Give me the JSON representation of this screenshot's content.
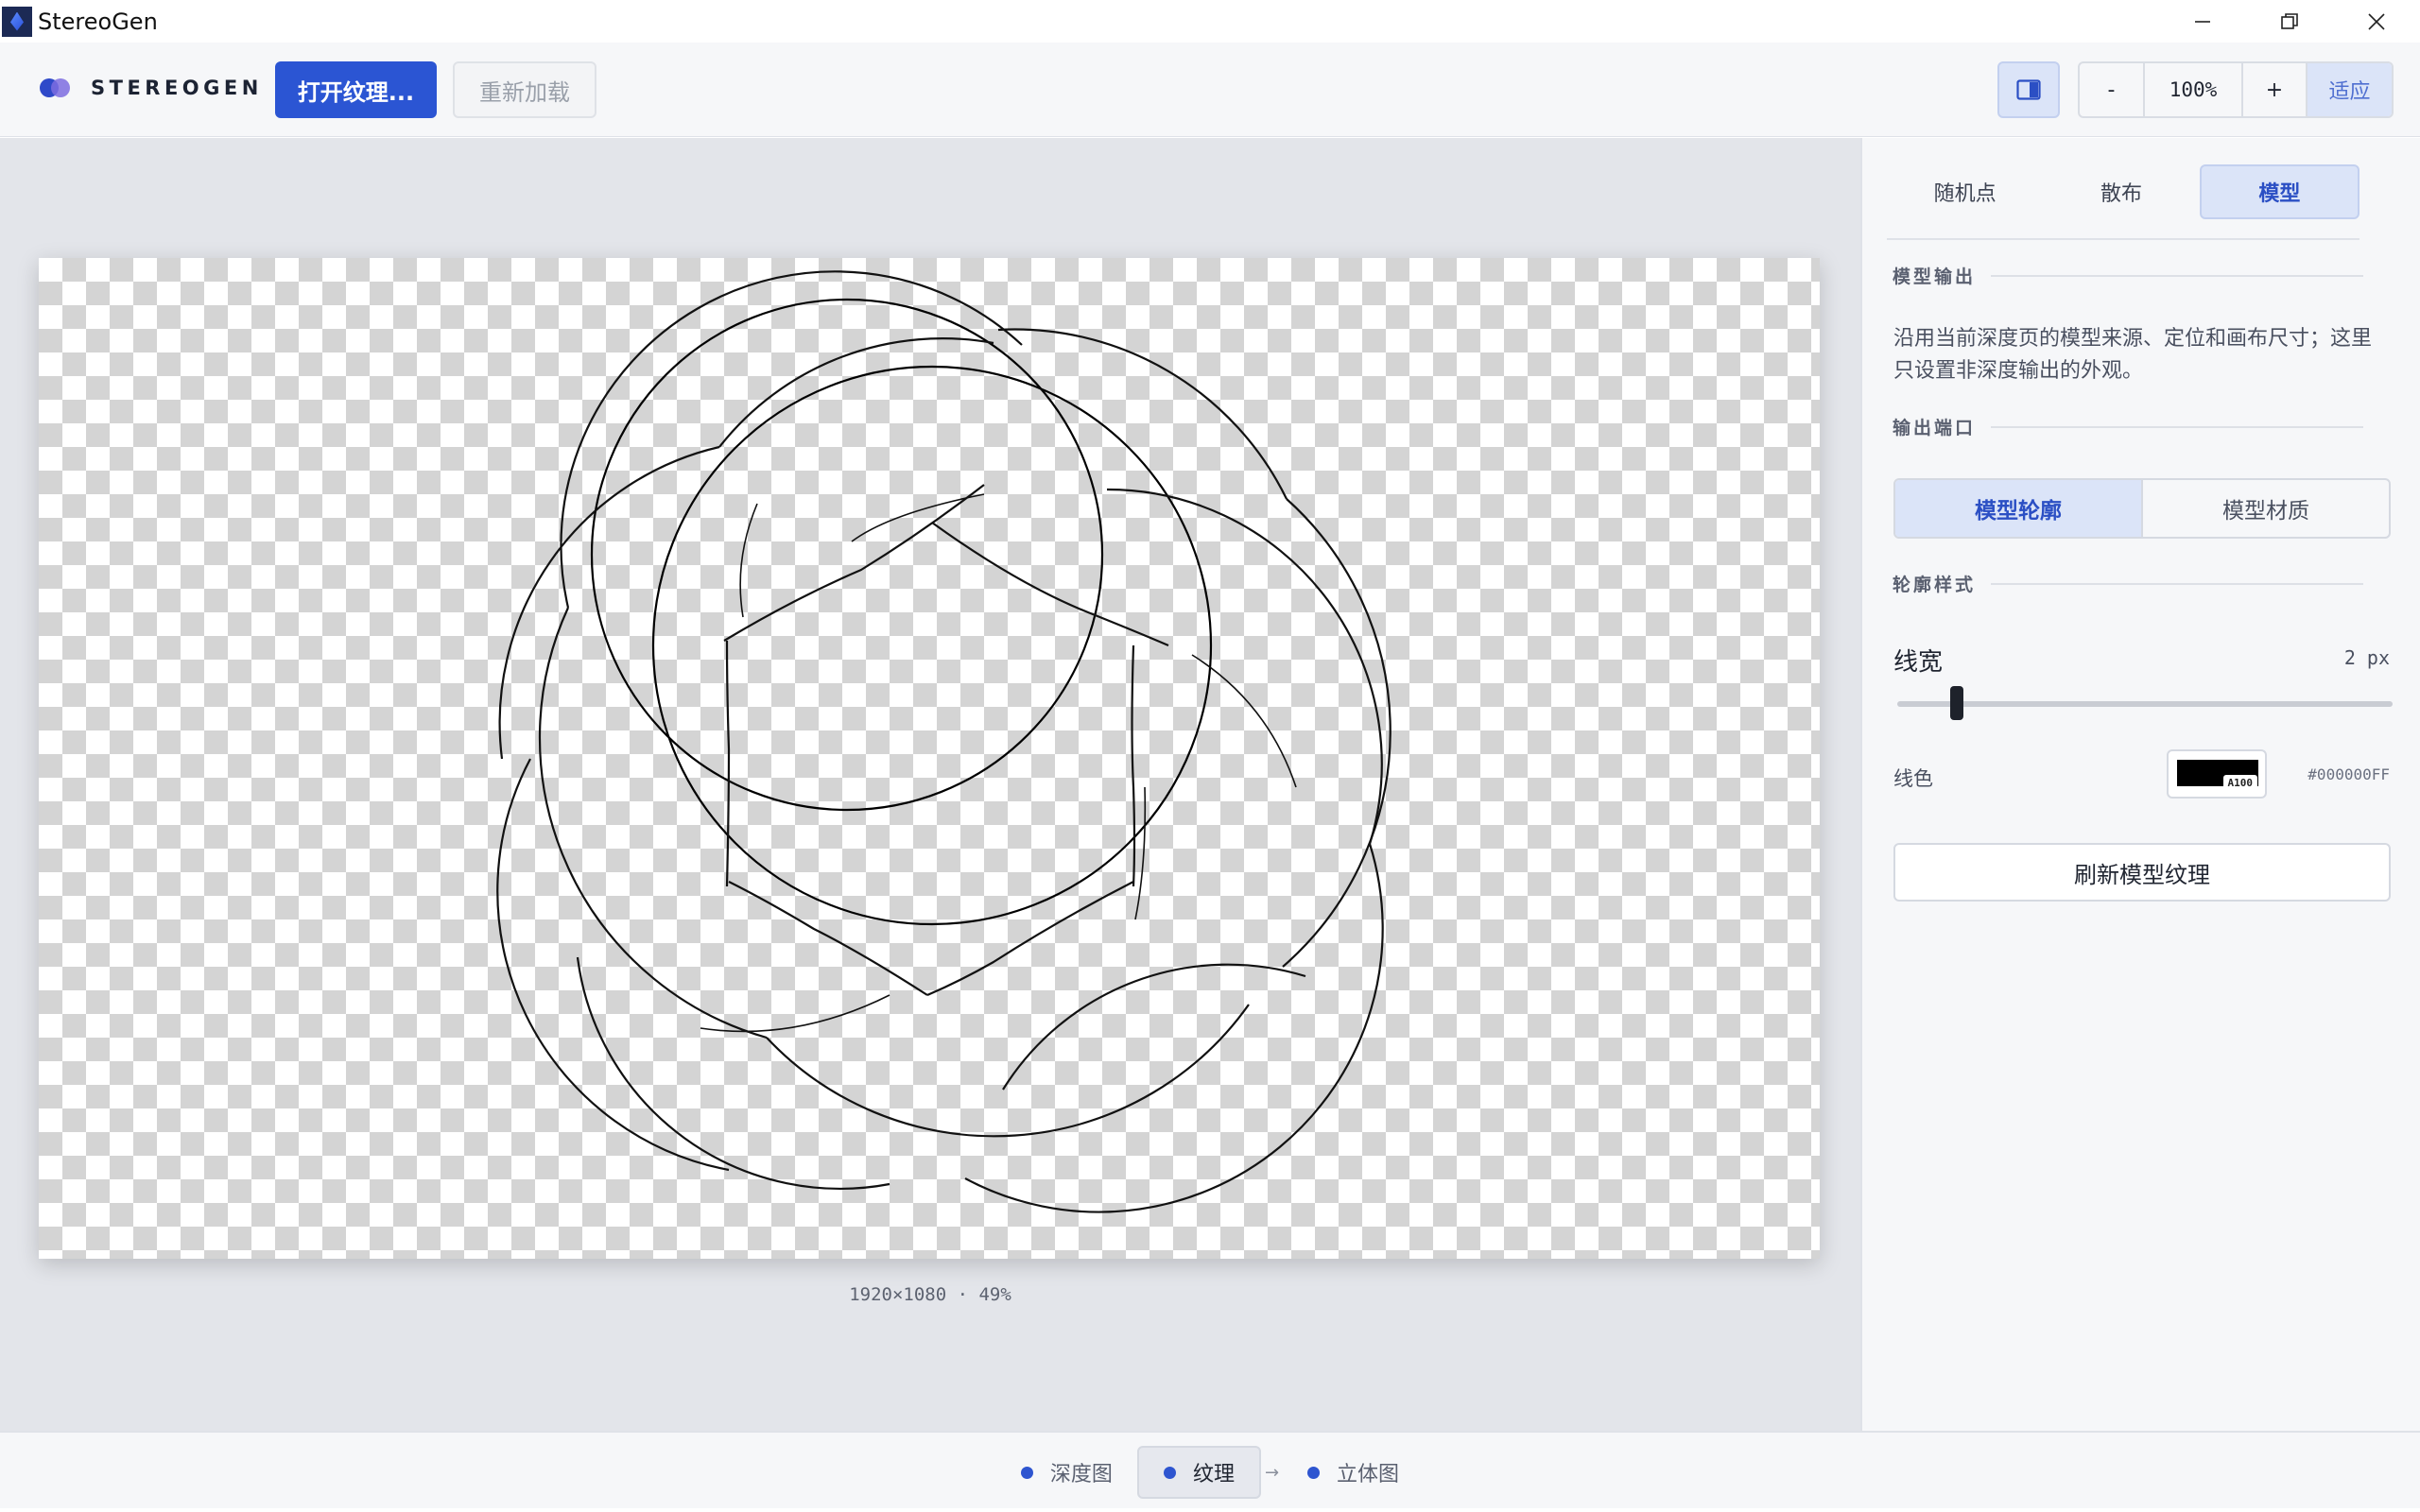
{
  "window": {
    "title": "StereoGen",
    "controls": [
      "minimize-icon",
      "restore-icon",
      "close-icon"
    ]
  },
  "toolbar": {
    "brand": "STEREOGEN",
    "open_texture_label": "打开纹理...",
    "reload_label": "重新加载",
    "panel_toggle_icon": "sidebar-toggle-icon",
    "zoom_out_label": "-",
    "zoom_level": "100%",
    "zoom_in_label": "+",
    "fit_label": "适应"
  },
  "canvas": {
    "caption": "1920×1080 · 49%"
  },
  "sidebar": {
    "tabs": [
      {
        "label": "随机点",
        "active": false
      },
      {
        "label": "散布",
        "active": false
      },
      {
        "label": "模型",
        "active": true
      }
    ],
    "model_output_header": "模型输出",
    "description": "沿用当前深度页的模型来源、定位和画布尺寸；这里只设置非深度输出的外观。",
    "output_port_header": "输出端口",
    "output_ports": [
      {
        "label": "模型轮廓",
        "active": true
      },
      {
        "label": "模型材质",
        "active": false
      }
    ],
    "outline_style_header": "轮廓样式",
    "line_width_label": "线宽",
    "line_width_value": "2 px",
    "line_width_fraction": 0.12,
    "line_color_label": "线色",
    "line_color_alpha_badge": "A100",
    "line_color_hex": "#000000FF",
    "refresh_label": "刷新模型纹理"
  },
  "status": {
    "stages": [
      {
        "label": "深度图",
        "active": false
      },
      {
        "label": "纹理",
        "active": true
      },
      {
        "label": "立体图",
        "active": false
      }
    ],
    "arrow": "→"
  },
  "colors": {
    "accent": "#2b55d3",
    "accent_soft": "#dbe4f8",
    "dot": "#2e55d0"
  }
}
